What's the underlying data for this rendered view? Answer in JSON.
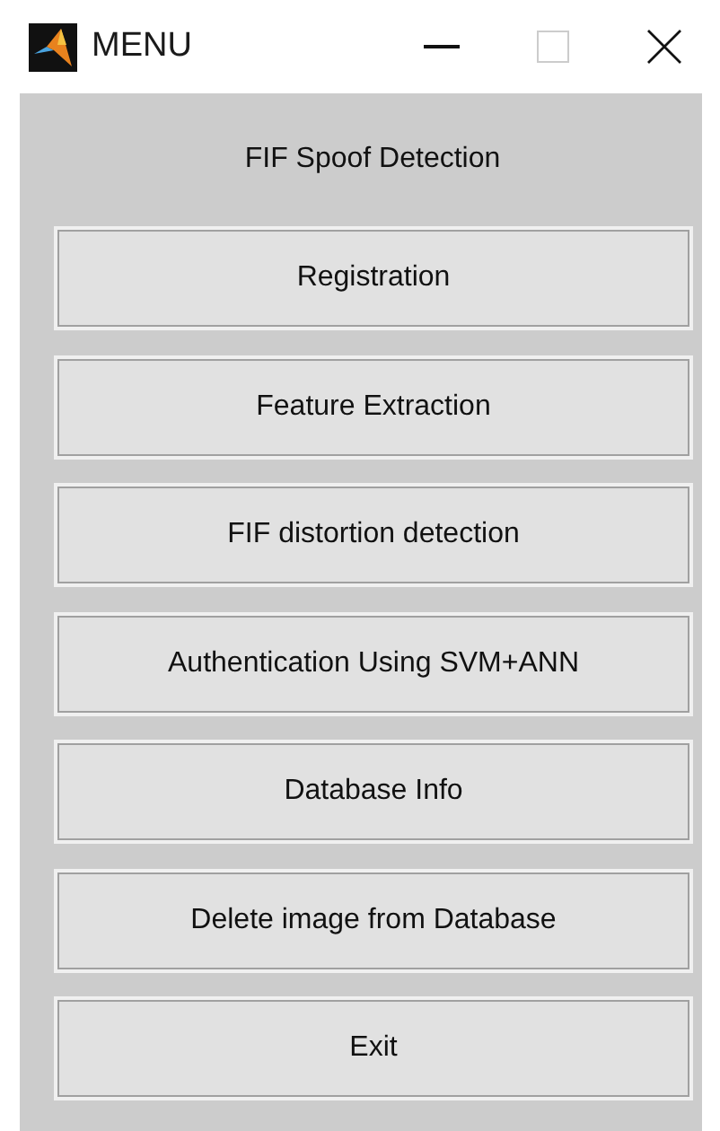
{
  "window": {
    "title": "MENU"
  },
  "heading": "FIF Spoof Detection",
  "buttons": [
    "Registration",
    "Feature Extraction",
    "FIF distortion detection",
    "Authentication Using SVM+ANN",
    "Database Info",
    "Delete image from Database",
    "Exit"
  ]
}
